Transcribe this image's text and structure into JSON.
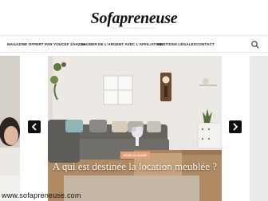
{
  "site": {
    "title": "Sofapreneuse",
    "tagline": "devenir entrepreneuse en ligne"
  },
  "nav": {
    "items": [
      {
        "label": "MAGAZINE OFFERT PAR YOUCEF ZAHZAH"
      },
      {
        "label": "GAGNER DE L'ARGENT AVEC L'AFFILIATION"
      },
      {
        "label": "MENTIONS LÉGALES"
      },
      {
        "label": "CONTACT"
      }
    ],
    "search_icon": "search-icon"
  },
  "slider": {
    "category_badge": "NON CLASSÉ",
    "headline": "A qui est destinée la location meublée ?",
    "prev_icon": "chevron-left-icon",
    "next_icon": "chevron-right-icon"
  },
  "watermark": "www.sofapreneuse.com",
  "colors": {
    "badge": "#e6a07a",
    "arrow_bg": "#111111",
    "wall": "#e9e6e0",
    "sofa": "#6a6864"
  }
}
